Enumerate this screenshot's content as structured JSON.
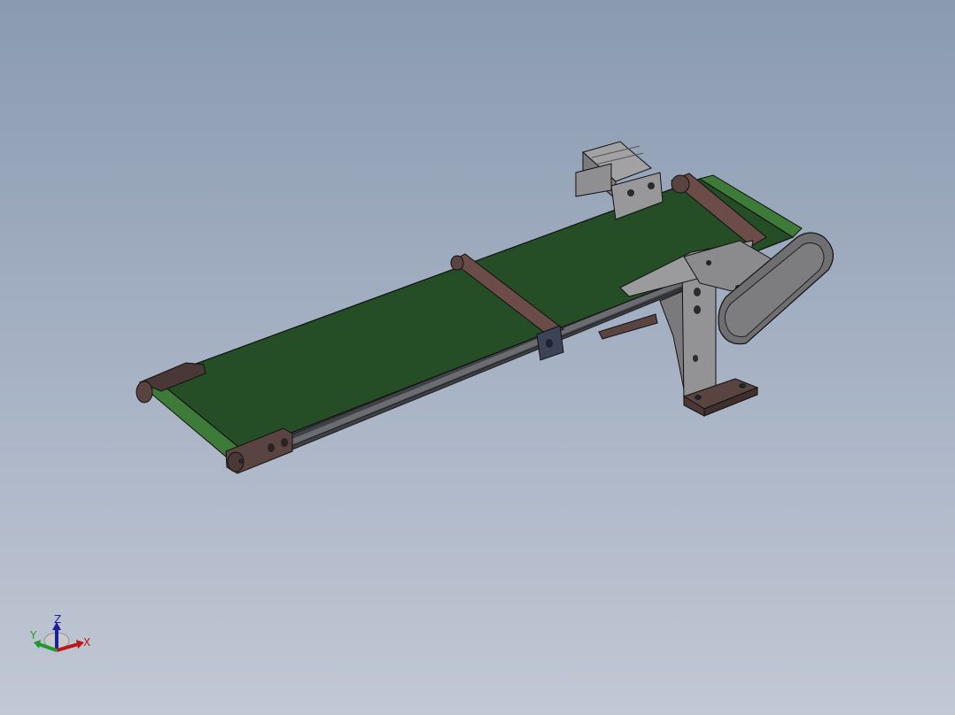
{
  "viewport": {
    "background_top": "#8a9ab0",
    "background_bottom": "#c2c8d4"
  },
  "model": {
    "belt_color": "#254d26",
    "belt_edge_color": "#3e7a38",
    "frame_color": "#4d4f55",
    "bracket_color": "#5a4441",
    "metal_color": "#8f8f92"
  },
  "triad": {
    "x_label": "X",
    "y_label": "Y",
    "z_label": "Z",
    "x_color": "#c0141c",
    "y_color": "#1f9a2a",
    "z_color": "#1a1f9e"
  }
}
